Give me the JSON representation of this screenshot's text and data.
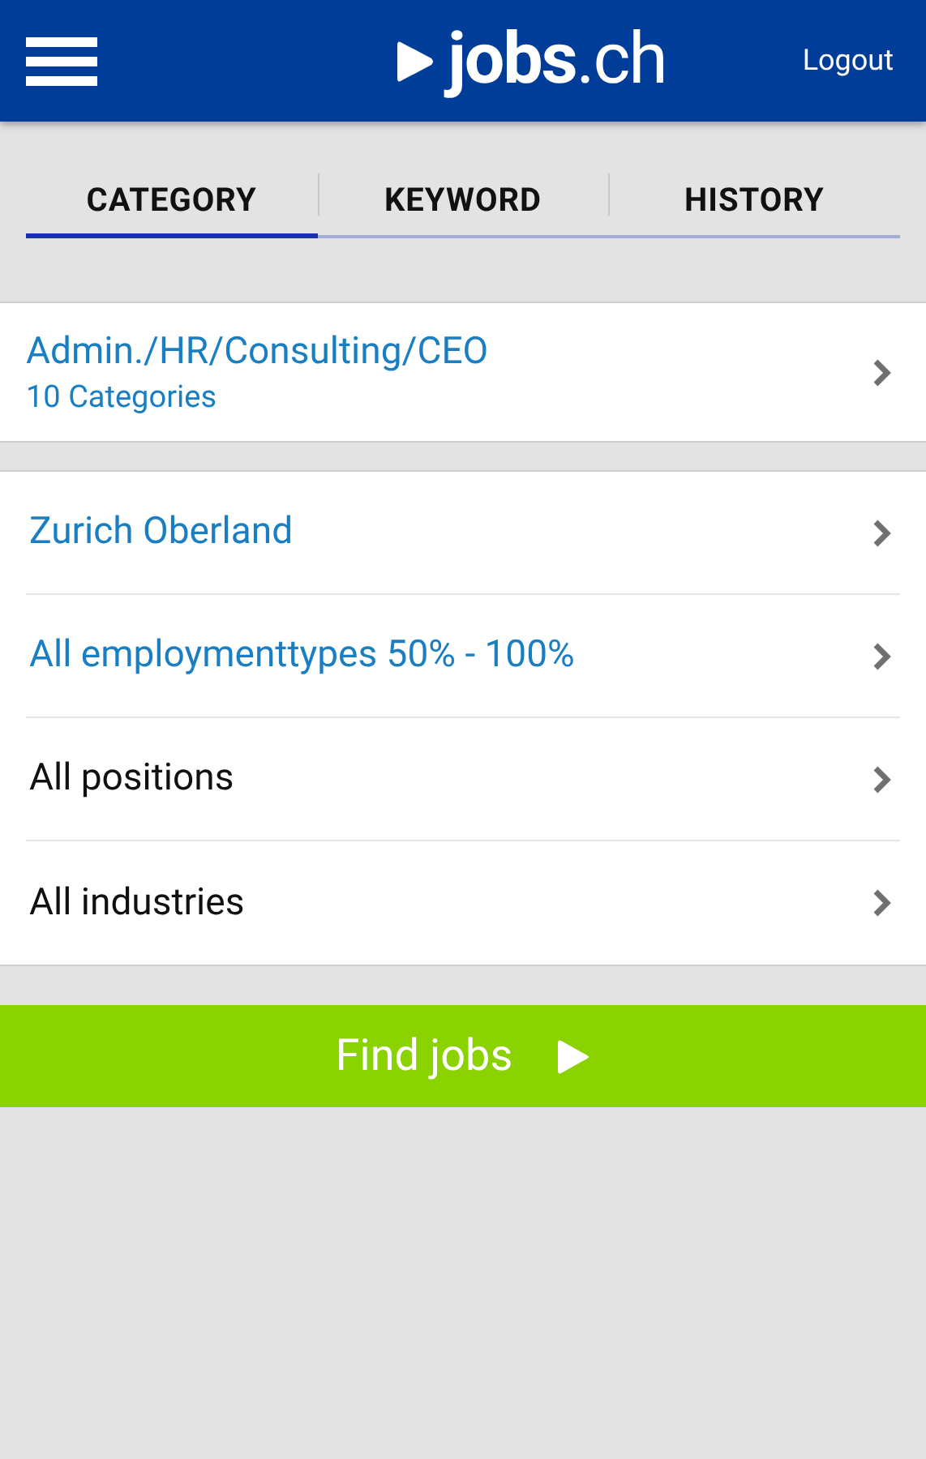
{
  "header": {
    "logo": "**jobs**.ch",
    "logout": "Logout"
  },
  "tabs": [
    {
      "label": "CATEGORY",
      "selected": true
    },
    {
      "label": "KEYWORD",
      "selected": false
    },
    {
      "label": "HISTORY",
      "selected": false
    }
  ],
  "category": {
    "title": "Admin./HR/Consulting/CEO",
    "subtitle": "10 Categories"
  },
  "filters": [
    {
      "label": "Zurich Oberland",
      "active": true
    },
    {
      "label": "All employmenttypes 50% - 100%",
      "active": true
    },
    {
      "label": "All positions",
      "active": false
    },
    {
      "label": "All industries",
      "active": false
    }
  ],
  "find_button": "Find jobs"
}
